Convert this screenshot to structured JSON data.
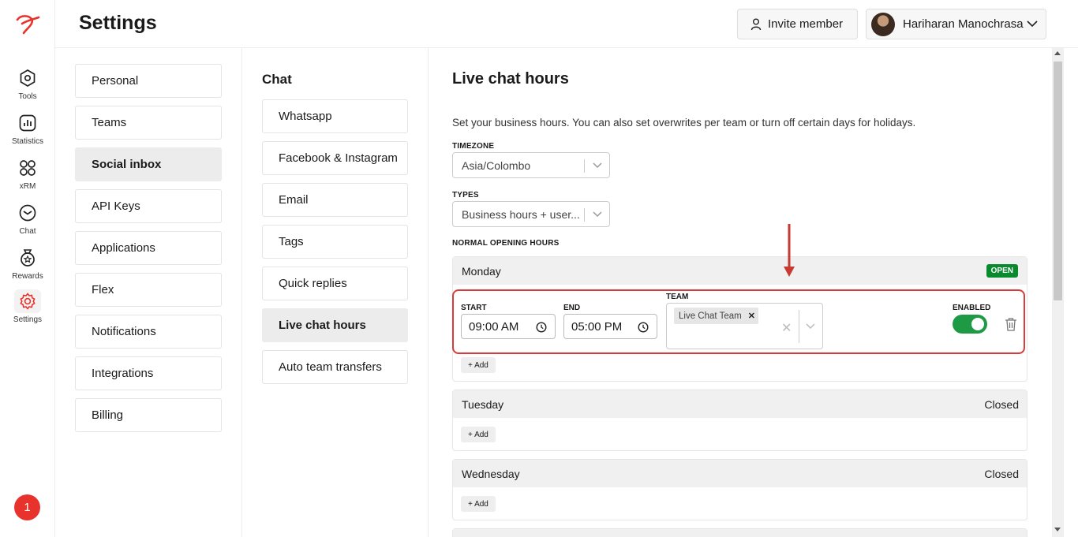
{
  "header": {
    "title": "Settings",
    "invite_label": "Invite member",
    "user_name": "Hariharan Manochrasa"
  },
  "rail": {
    "items": [
      {
        "label": "Tools",
        "icon": "tools-icon"
      },
      {
        "label": "Statistics",
        "icon": "statistics-icon"
      },
      {
        "label": "xRM",
        "icon": "xrm-icon"
      },
      {
        "label": "Chat",
        "icon": "chat-icon"
      },
      {
        "label": "Rewards",
        "icon": "rewards-icon"
      },
      {
        "label": "Settings",
        "icon": "settings-icon"
      }
    ],
    "notification_count": "1"
  },
  "settings_nav": {
    "items": [
      "Personal",
      "Teams",
      "Social inbox",
      "API Keys",
      "Applications",
      "Flex",
      "Notifications",
      "Integrations",
      "Billing"
    ],
    "active": "Social inbox"
  },
  "chat_nav": {
    "title": "Chat",
    "items": [
      "Whatsapp",
      "Facebook & Instagram",
      "Email",
      "Tags",
      "Quick replies",
      "Live chat hours",
      "Auto team transfers"
    ],
    "active": "Live chat hours"
  },
  "main": {
    "title": "Live chat hours",
    "description": "Set your business hours. You can also set overwrites per team or turn off certain days for holidays.",
    "timezone_label": "TIMEZONE",
    "timezone_value": "Asia/Colombo",
    "types_label": "TYPES",
    "types_value": "Business hours + user...",
    "opening_hours_label": "NORMAL OPENING HOURS",
    "days": [
      {
        "name": "Monday",
        "status": "OPEN",
        "slot": {
          "start_label": "START",
          "start": "09:00 AM",
          "end_label": "END",
          "end": "05:00 PM",
          "team_label": "TEAM",
          "team": "Live Chat Team",
          "enabled_label": "ENABLED",
          "enabled": true
        },
        "add_label": "+ Add"
      },
      {
        "name": "Tuesday",
        "status": "Closed",
        "add_label": "+ Add"
      },
      {
        "name": "Wednesday",
        "status": "Closed",
        "add_label": "+ Add"
      }
    ]
  },
  "colors": {
    "accent": "#e8322c",
    "open_badge": "#0a8a2e",
    "toggle_on": "#1e9a45",
    "highlight": "#d93a3a"
  }
}
